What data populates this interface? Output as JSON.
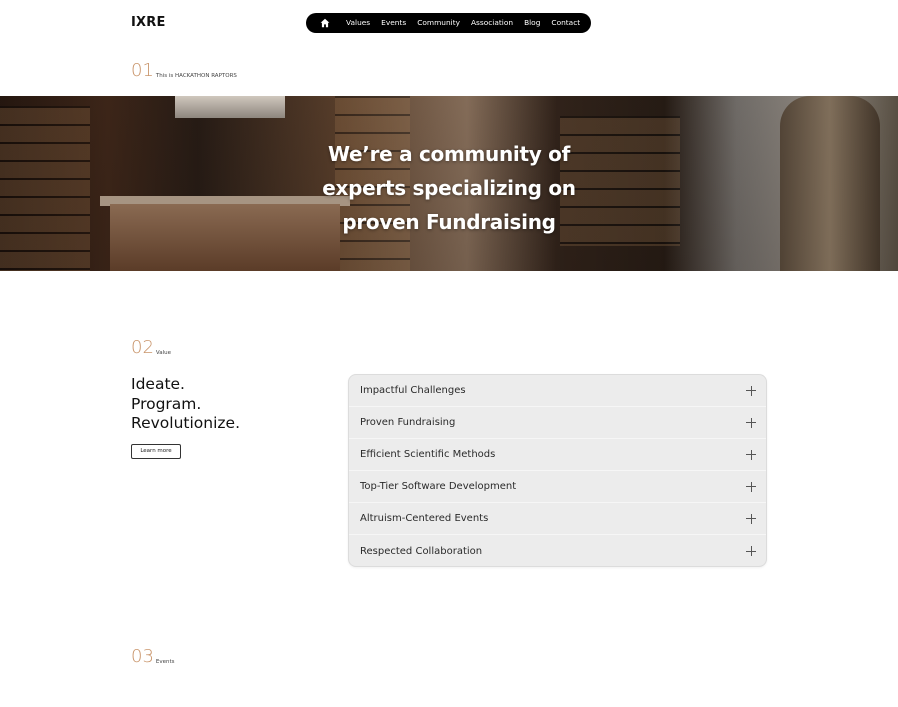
{
  "header": {
    "logo": "IXRE",
    "nav": {
      "home_icon": "home-icon",
      "items": [
        "Values",
        "Events",
        "Community",
        "Association",
        "Blog",
        "Contact"
      ]
    }
  },
  "section1": {
    "number": "01",
    "subtitle": "This is HACKATHON RAPTORS"
  },
  "hero": {
    "title_lines": [
      "We’re a community of",
      "experts specializing on",
      "proven Fundraising"
    ]
  },
  "section2": {
    "number": "02",
    "subtitle": "Value",
    "tagline": [
      "Ideate.",
      "Program.",
      "Revolutionize."
    ],
    "learn_more_label": "Learn more",
    "accordion": [
      "Impactful Challenges",
      "Proven Fundraising",
      "Efficient Scientific Methods",
      "Top-Tier Software Development",
      "Altruism-Centered Events",
      "Respected Collaboration"
    ]
  },
  "section3": {
    "number": "03",
    "subtitle": "Events"
  },
  "colors": {
    "accent": "#c9956b",
    "nav_bg": "#000000",
    "accordion_bg": "#ececec"
  }
}
